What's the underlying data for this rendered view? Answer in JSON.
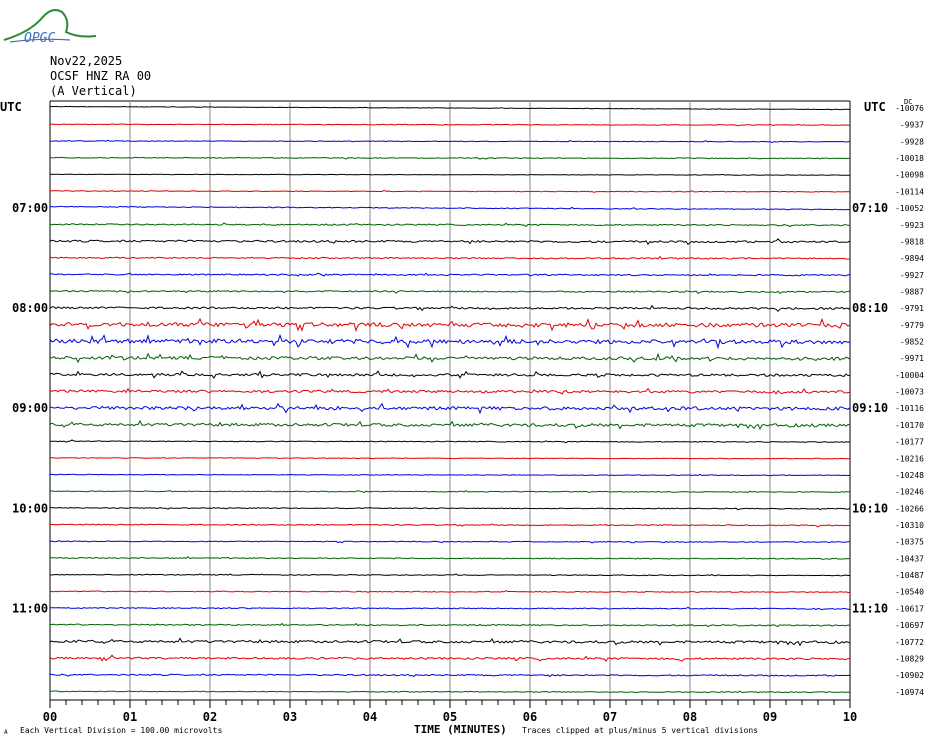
{
  "logo": {
    "text": "OPGC"
  },
  "header": {
    "date": "Nov22,2025",
    "station": "OCSF HNZ RA 00",
    "component": "(A Vertical)"
  },
  "colors": {
    "trace_cycle": [
      "#000000",
      "#e00000",
      "#0000e0",
      "#006000"
    ],
    "grid": "#888888"
  },
  "chart_data": {
    "type": "line",
    "title": "OCSF HNZ RA 00 (A Vertical) Nov22,2025",
    "xlabel": "TIME (MINUTES)",
    "xlim": [
      0,
      10
    ],
    "x_ticks": [
      "00",
      "01",
      "02",
      "03",
      "04",
      "05",
      "06",
      "07",
      "08",
      "09",
      "10"
    ],
    "left_axis_title": "UTC",
    "right_axis_title": "UTC",
    "dc_label": "DC",
    "left_hour_labels": [
      {
        "row": 6,
        "label": "07:00"
      },
      {
        "row": 12,
        "label": "08:00"
      },
      {
        "row": 18,
        "label": "09:00"
      },
      {
        "row": 24,
        "label": "10:00"
      },
      {
        "row": 30,
        "label": "11:00"
      }
    ],
    "right_hour_labels": [
      {
        "row": 6,
        "label": "07:10"
      },
      {
        "row": 12,
        "label": "08:10"
      },
      {
        "row": 18,
        "label": "09:10"
      },
      {
        "row": 24,
        "label": "10:10"
      },
      {
        "row": 30,
        "label": "11:10"
      }
    ],
    "trace_minutes": 10,
    "dc_offsets": [
      -10076,
      -9937,
      -9928,
      -10018,
      -10098,
      -10114,
      -10052,
      -9923,
      -9818,
      -9894,
      -9927,
      -9887,
      -9791,
      -9779,
      -9852,
      -9971,
      -10004,
      -10073,
      -10116,
      -10170,
      -10177,
      -10216,
      -10248,
      -10246,
      -10266,
      -10310,
      -10375,
      -10437,
      -10487,
      -10540,
      -10617,
      -10697,
      -10772,
      -10829,
      -10902,
      -10974
    ],
    "relative_activity": [
      0.3,
      0.4,
      0.4,
      0.5,
      0.3,
      0.4,
      0.5,
      0.8,
      1.2,
      0.8,
      0.8,
      0.8,
      1.2,
      2.5,
      2.5,
      1.8,
      1.5,
      1.5,
      2.0,
      1.8,
      0.5,
      0.4,
      0.4,
      0.5,
      0.5,
      0.6,
      0.5,
      0.6,
      0.5,
      0.5,
      0.6,
      0.8,
      1.5,
      1.2,
      0.8,
      0.5
    ],
    "vertical_scale": "Each Vertical Division =  100.00 microvolts",
    "clip_note": "Traces clipped at plus/minus 5 vertical divisions"
  }
}
